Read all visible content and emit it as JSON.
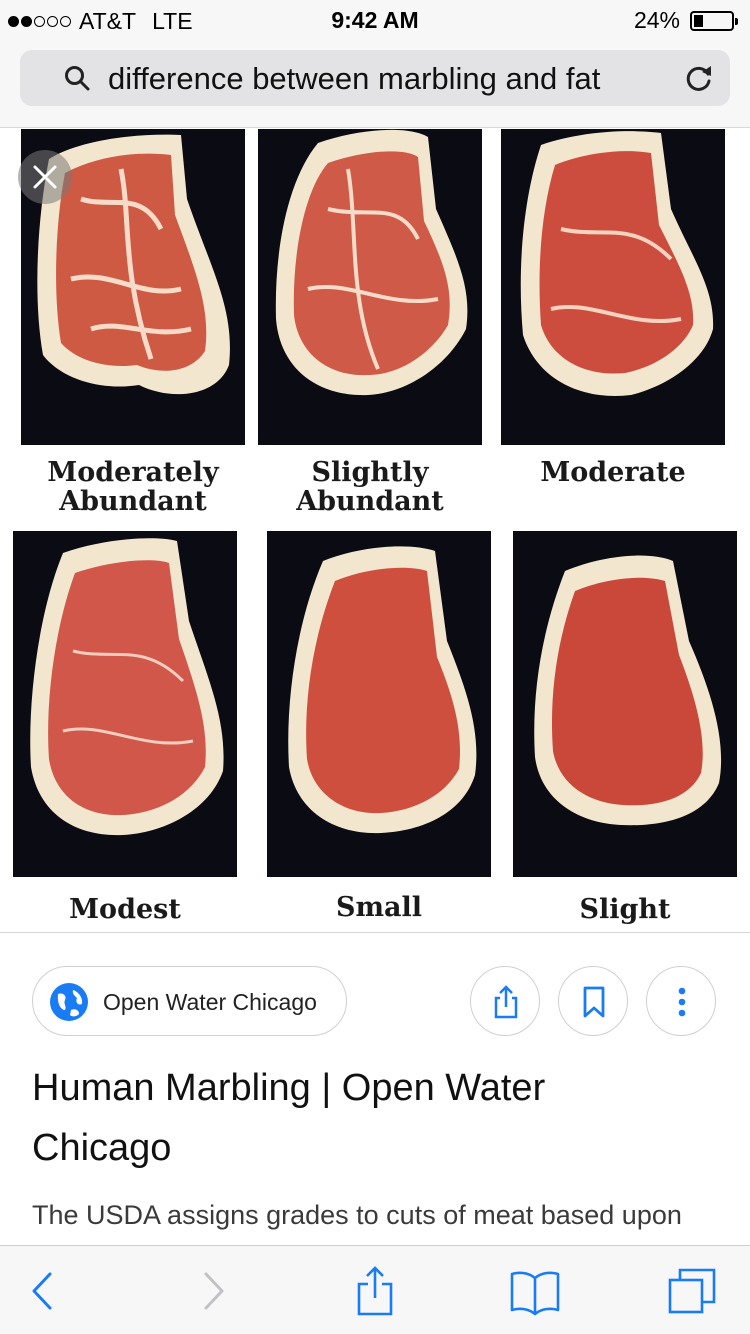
{
  "status_bar": {
    "signal": [
      true,
      true,
      false,
      false,
      false
    ],
    "carrier": "AT&T",
    "network": "LTE",
    "time": "9:42 AM",
    "battery_text": "24%",
    "battery_level": 0.24
  },
  "url_bar": {
    "query": "difference between marbling and fat",
    "search_icon": "search-icon",
    "reload_icon": "reload-icon"
  },
  "image_viewer": {
    "close_icon": "close-icon",
    "grades": [
      {
        "label_line1": "Moderately",
        "label_line2": "Abundant"
      },
      {
        "label_line1": "Slightly",
        "label_line2": "Abundant"
      },
      {
        "label_line1": "Moderate",
        "label_line2": ""
      },
      {
        "label_line1": "Modest",
        "label_line2": ""
      },
      {
        "label_line1": "Small",
        "label_line2": ""
      },
      {
        "label_line1": "Slight",
        "label_line2": ""
      }
    ]
  },
  "result": {
    "source_name": "Open Water Chicago",
    "source_icon": "globe-icon",
    "actions": [
      "share-icon",
      "bookmark-icon",
      "more-icon"
    ],
    "title": "Human Marbling | Open Water Chicago",
    "snippet": "The USDA assigns grades to cuts of meat based upon"
  },
  "toolbar": {
    "icons": [
      "back-icon",
      "forward-icon",
      "share-icon",
      "bookmarks-icon",
      "tabs-icon"
    ]
  },
  "colors": {
    "accent": "#1a7cf5",
    "panel_bg": "#0b0b14",
    "meat": "#c8423a",
    "fat": "#f3e6cf"
  }
}
